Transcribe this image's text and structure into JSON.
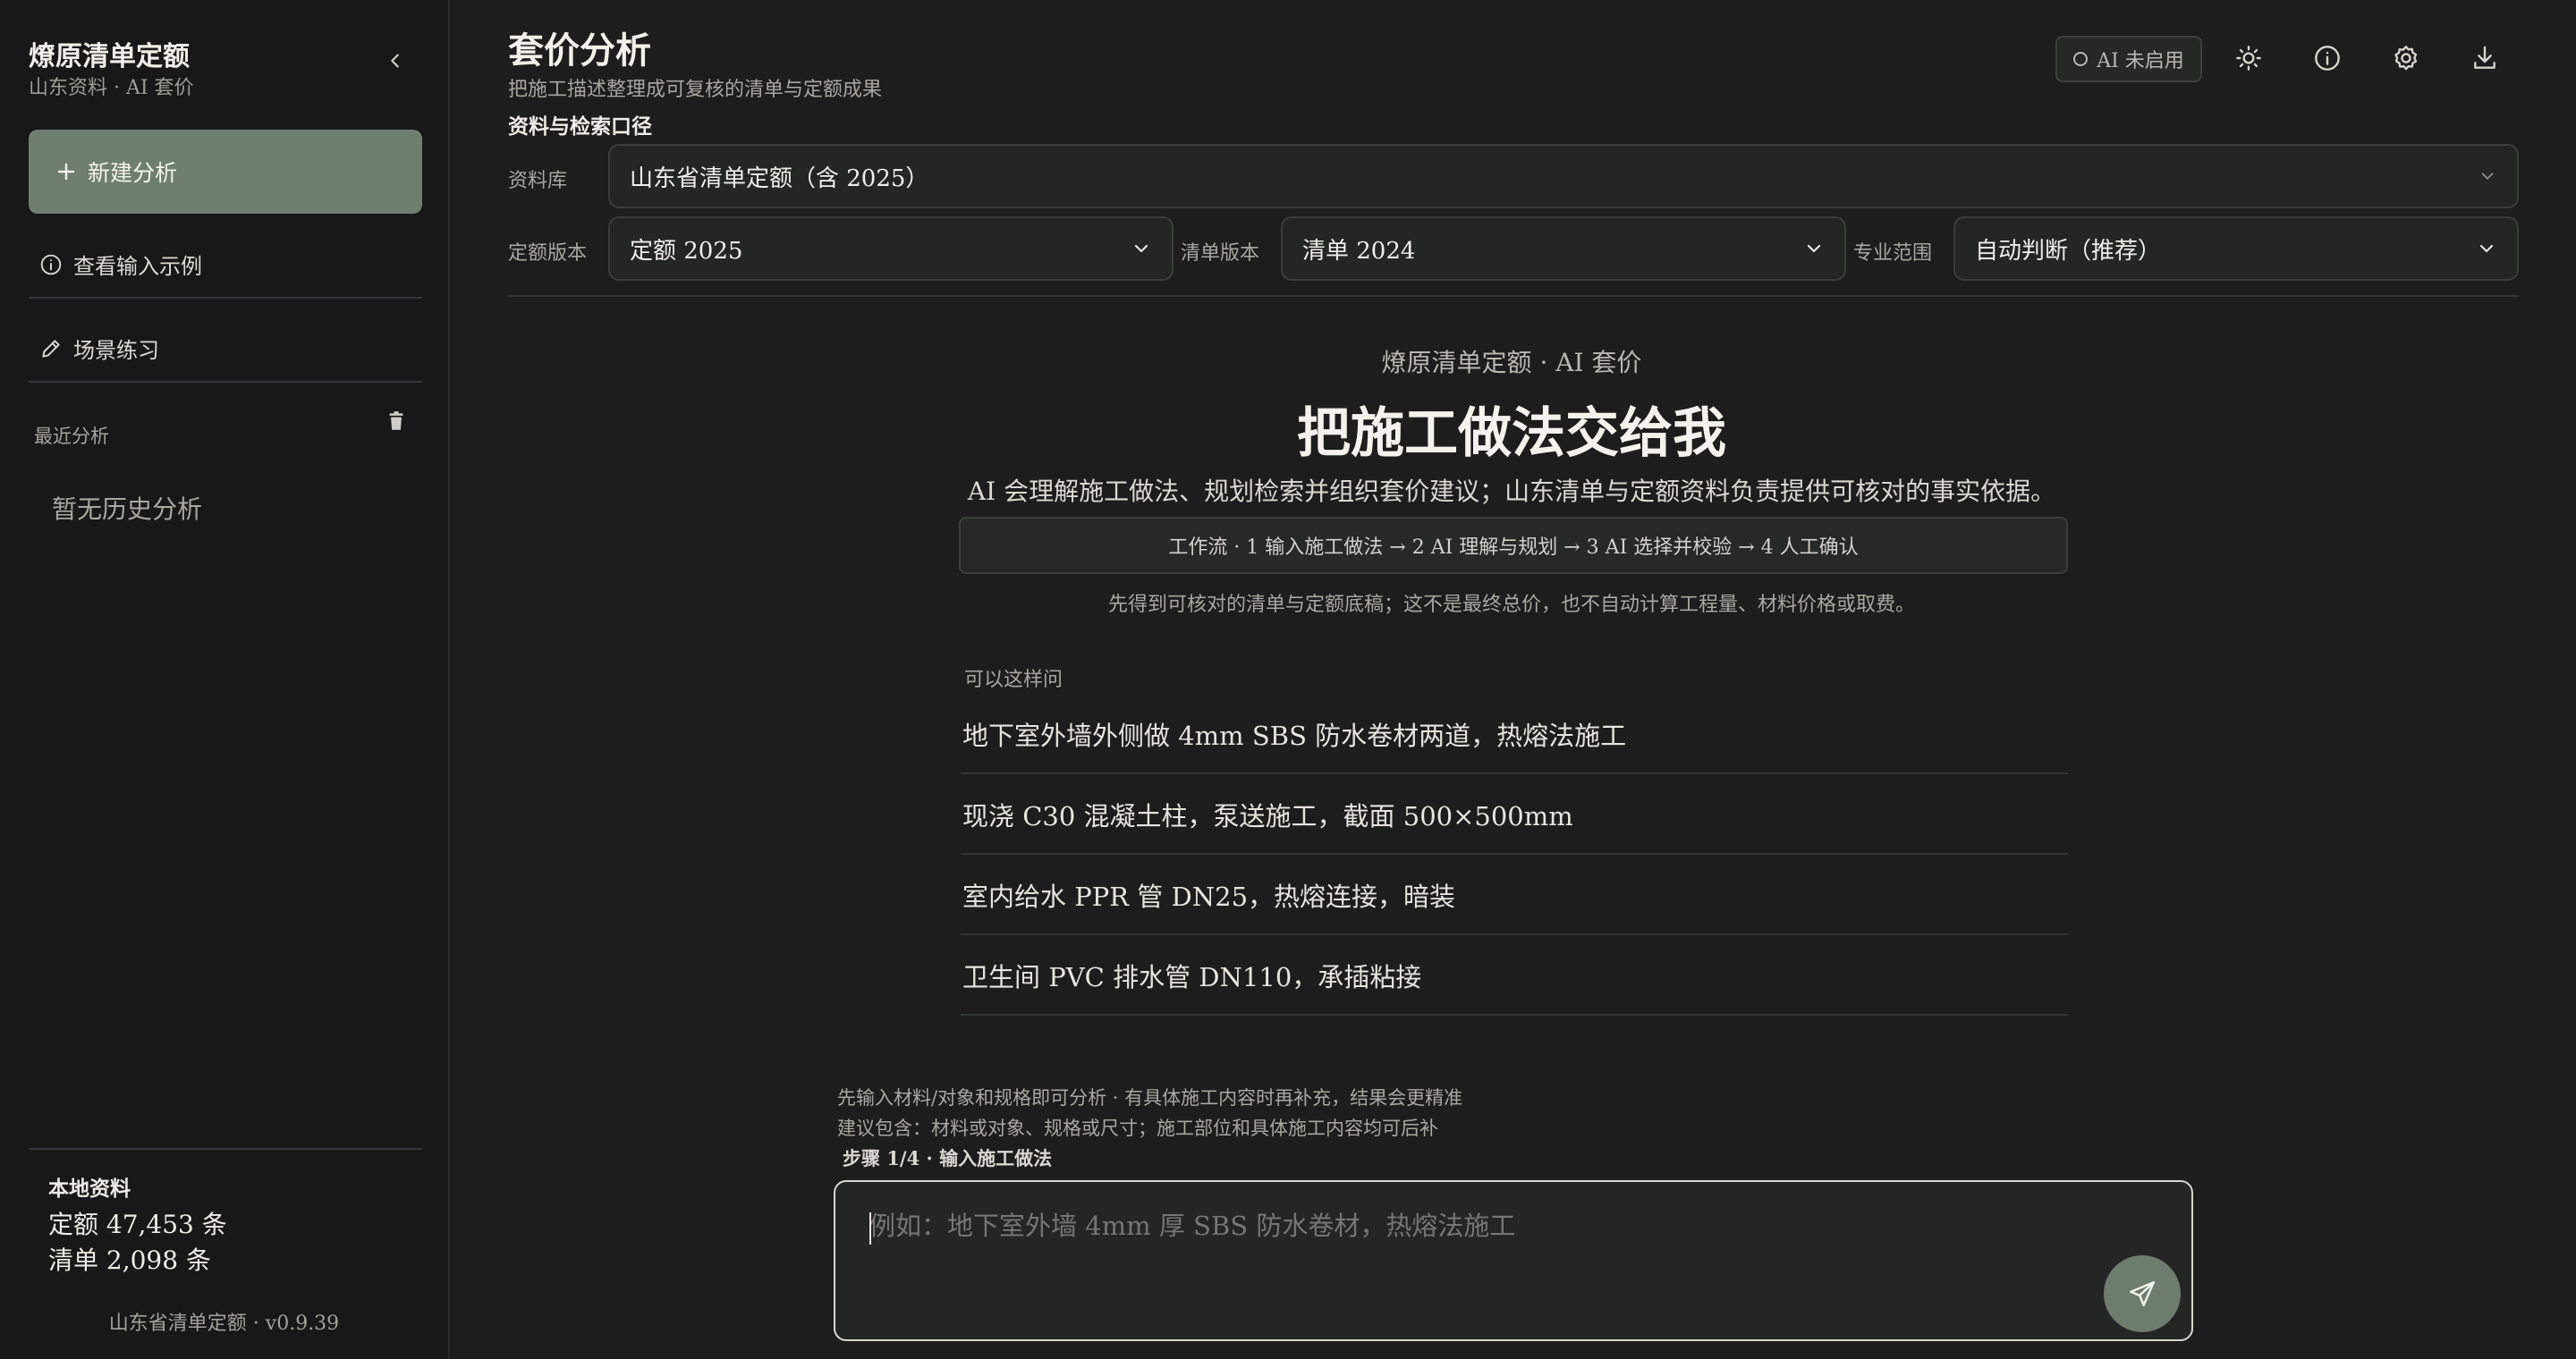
{
  "sidebar": {
    "brand_title": "燎原清单定额",
    "brand_subtitle": "山东资料 · AI 套价",
    "new_analysis": "新建分析",
    "view_examples": "查看输入示例",
    "scene_practice": "场景练习",
    "recent_label": "最近分析",
    "empty_history": "暂无历史分析",
    "local_title": "本地资料",
    "quota_count": "定额 47,453 条",
    "list_count": "清单 2,098 条",
    "version": "山东省清单定额 · v0.9.39"
  },
  "header": {
    "title": "套价分析",
    "subtitle": "把施工描述整理成可复核的清单与定额成果",
    "ai_status": "AI 未启用"
  },
  "filters": {
    "section_label": "资料与检索口径",
    "library_label": "资料库",
    "library_value": "山东省清单定额（含 2025）",
    "quota_label": "定额版本",
    "quota_value": "定额 2025",
    "list_label": "清单版本",
    "list_value": "清单 2024",
    "scope_label": "专业范围",
    "scope_value": "自动判断（推荐）"
  },
  "hero": {
    "kicker": "燎原清单定额 · AI 套价",
    "title": "把施工做法交给我",
    "description": "AI 会理解施工做法、规划检索并组织套价建议；山东清单与定额资料负责提供可核对的事实依据。",
    "workflow": "工作流 · 1 输入施工做法 → 2 AI 理解与规划 → 3 AI 选择并校验 → 4 人工确认",
    "note": "先得到可核对的清单与定额底稿；这不是最终总价，也不自动计算工程量、材料价格或取费。"
  },
  "examples": {
    "label": "可以这样问",
    "items": [
      "地下室外墙外侧做 4mm SBS 防水卷材两道，热熔法施工",
      "现浇 C30 混凝土柱，泵送施工，截面 500×500mm",
      "室内给水 PPR 管 DN25，热熔连接，暗装",
      "卫生间 PVC 排水管 DN110，承插粘接"
    ]
  },
  "composer": {
    "hint1": "先输入材料/对象和规格即可分析 · 有具体施工内容时再补充，结果会更精准",
    "hint2": "建议包含：材料或对象、规格或尺寸；施工部位和具体施工内容均可后补",
    "step": "步骤 1/4 · 输入施工做法",
    "placeholder": "例如：地下室外墙 4mm 厚 SBS 防水卷材，热熔法施工",
    "value": ""
  },
  "colors": {
    "accent": "#6f7e6f",
    "background": "#1c1d1c",
    "sidebar": "#171817"
  }
}
